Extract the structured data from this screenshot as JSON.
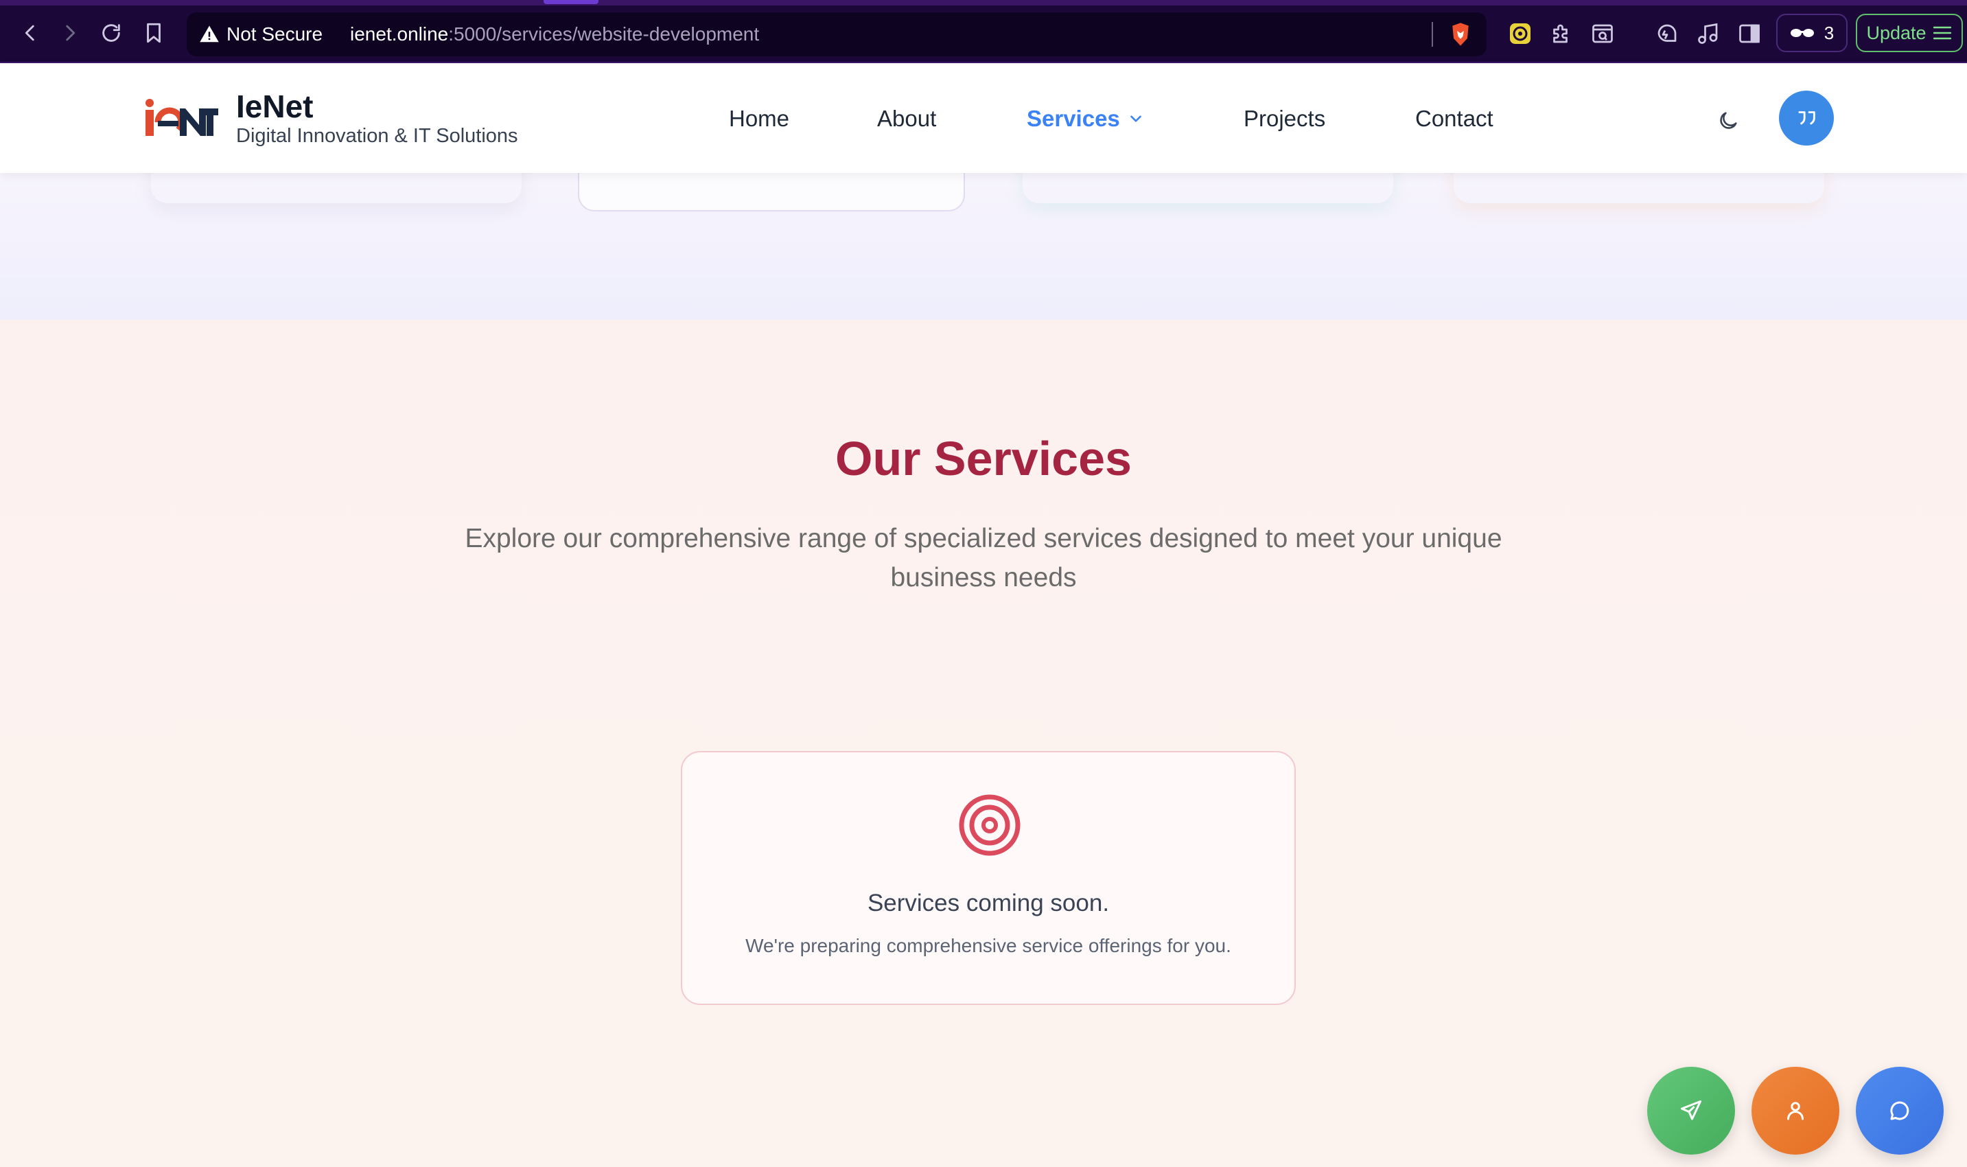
{
  "browser": {
    "security_label": "Not Secure",
    "url_host": "ienet.online",
    "url_path": ":5000/services/website-development",
    "shields_count": "3",
    "update_label": "Update"
  },
  "header": {
    "brand_name": "IeNet",
    "tagline": "Digital Innovation & IT Solutions",
    "nav": {
      "home": "Home",
      "about": "About",
      "services": "Services",
      "projects": "Projects",
      "contact": "Contact"
    },
    "active_nav": "services"
  },
  "services": {
    "title": "Our Services",
    "subtitle": "Explore our comprehensive range of specialized services designed to meet your unique business needs",
    "empty_title": "Services coming soon.",
    "empty_text": "We're preparing comprehensive service offerings for you."
  },
  "colors": {
    "accent_blue": "#3b82f6",
    "title_red": "#a52442",
    "target_red": "#dc4a5e",
    "fab_green": "#52b96a",
    "fab_orange": "#ea7a30",
    "fab_blue": "#437ee8"
  },
  "icons": {
    "fab_left": "send-icon",
    "fab_middle": "user-icon",
    "fab_right": "chat-icon",
    "empty_state": "target-icon"
  }
}
